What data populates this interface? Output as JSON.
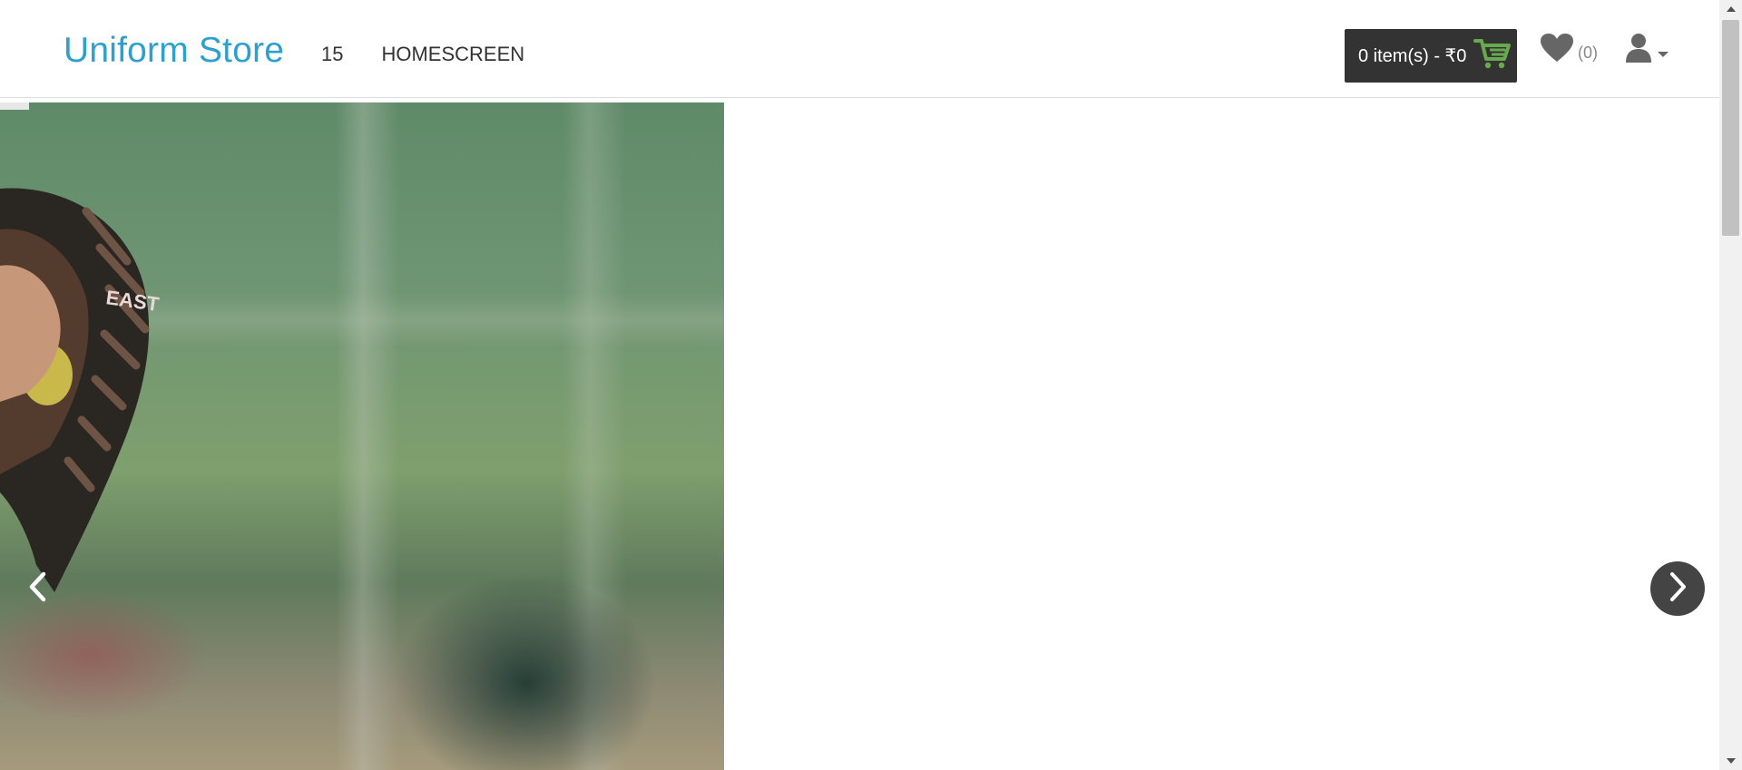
{
  "header": {
    "brand": "Uniform Store",
    "nav": [
      {
        "label": "15"
      },
      {
        "label": "HOMESCREEN"
      }
    ],
    "cart": {
      "label": "0 item(s) - ₹0",
      "icon": "cart-icon",
      "icon_color": "#6aa84f",
      "background": "#333333"
    },
    "wishlist": {
      "count": "(0)",
      "icon": "heart-icon"
    },
    "account": {
      "icon": "user-icon"
    }
  },
  "slider": {
    "image_alt": "Baseball glove",
    "prev_icon": "chevron-left-icon",
    "next_icon": "chevron-right-icon"
  },
  "colors": {
    "brand": "#2ea0d0",
    "text": "#333333",
    "muted": "#888888"
  }
}
